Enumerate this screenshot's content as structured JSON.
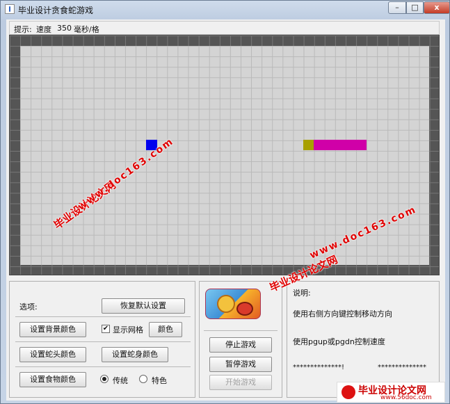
{
  "window": {
    "title": "毕业设计贪食蛇游戏",
    "min_label": "–",
    "max_label": "□",
    "close_label": "x"
  },
  "hint": {
    "prefix": "提示:",
    "speed_label": "速度",
    "speed_value": "350",
    "unit": "毫秒/格"
  },
  "board": {
    "grid_cols": 39,
    "grid_rows": 21,
    "food": {
      "col": 12,
      "row": 9
    },
    "snake": [
      {
        "col": 27,
        "row": 9,
        "part": "head"
      },
      {
        "col": 28,
        "row": 9,
        "part": "body"
      },
      {
        "col": 29,
        "row": 9,
        "part": "body"
      },
      {
        "col": 30,
        "row": 9,
        "part": "body"
      },
      {
        "col": 31,
        "row": 9,
        "part": "body"
      },
      {
        "col": 32,
        "row": 9,
        "part": "body"
      }
    ],
    "colors": {
      "wall": "#555555",
      "background": "#d4d4d4",
      "food": "#0000ee",
      "head": "#a8a000",
      "body": "#d000a8"
    }
  },
  "watermarks": [
    {
      "line1": "毕业设计论文网",
      "line2": "www.doc163.com"
    },
    {
      "line1": "毕业设计论文网",
      "line2": "www.doc163.com"
    }
  ],
  "options": {
    "title": "选项:",
    "restore_defaults": "恢复默认设置",
    "bg_color": "设置背景颜色",
    "show_grid": "显示网格",
    "show_grid_checked": true,
    "color": "颜色",
    "head_color": "设置蛇头颜色",
    "body_color": "设置蛇身颜色",
    "food_color": "设置食物颜色",
    "mode_traditional": "传统",
    "mode_special": "特色",
    "mode_selected": "traditional"
  },
  "controls": {
    "stop": "停止游戏",
    "pause": "暂停游戏",
    "start": "开始游戏",
    "logo_icon": "game-logo-icon"
  },
  "info": {
    "title": "说明:",
    "line1": "使用右侧方向键控制移动方向",
    "line2": "使用pgup或pgdn控制速度",
    "stars_left": "**************!",
    "stars_right": "**************"
  },
  "badge": {
    "name": "毕业设计论文网",
    "url": "www.56doc.com"
  }
}
